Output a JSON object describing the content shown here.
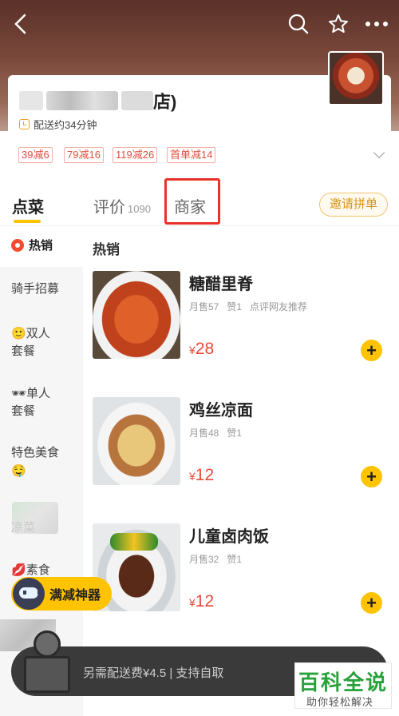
{
  "store": {
    "name_suffix": "店)",
    "delivery": "配送约34分钟"
  },
  "promos": [
    "39减6",
    "79减16",
    "119减26",
    "首单减14"
  ],
  "tabs": {
    "order": "点菜",
    "reviews": "评价",
    "reviews_count": "1090",
    "merchant": "商家",
    "invite": "邀请拼单"
  },
  "sidebar": {
    "items": [
      {
        "label": "热销"
      },
      {
        "label": "骑手招募"
      },
      {
        "emoji": "🙂",
        "label": "双人",
        "label2": "套餐"
      },
      {
        "emoji": "🕶",
        "label": "单人",
        "label2": "套餐"
      },
      {
        "label": "特色美食",
        "emoji2": "🤤"
      },
      {
        "label": "凉菜"
      },
      {
        "emoji": "💋",
        "label": "素食"
      }
    ]
  },
  "section": {
    "title": "热销"
  },
  "dishes": [
    {
      "name": "糖醋里脊",
      "sold": "月售57",
      "likes": "赞1",
      "tag": "点评网友推荐",
      "currency": "¥",
      "price": "28"
    },
    {
      "name": "鸡丝凉面",
      "sold": "月售48",
      "likes": "赞1",
      "tag": "",
      "currency": "¥",
      "price": "12"
    },
    {
      "name": "儿童卤肉饭",
      "sold": "月售32",
      "likes": "赞1",
      "tag": "",
      "currency": "¥",
      "price": "12"
    }
  ],
  "tool_button": {
    "label": "满减神器"
  },
  "cart": {
    "text": "另需配送费¥4.5 | 支持自取"
  },
  "watermark": {
    "title": "百科全说",
    "subtitle": "助你轻松解决"
  },
  "colors": {
    "accent": "#ffc300",
    "price": "#e84a3a",
    "highlight": "#e8322a"
  }
}
